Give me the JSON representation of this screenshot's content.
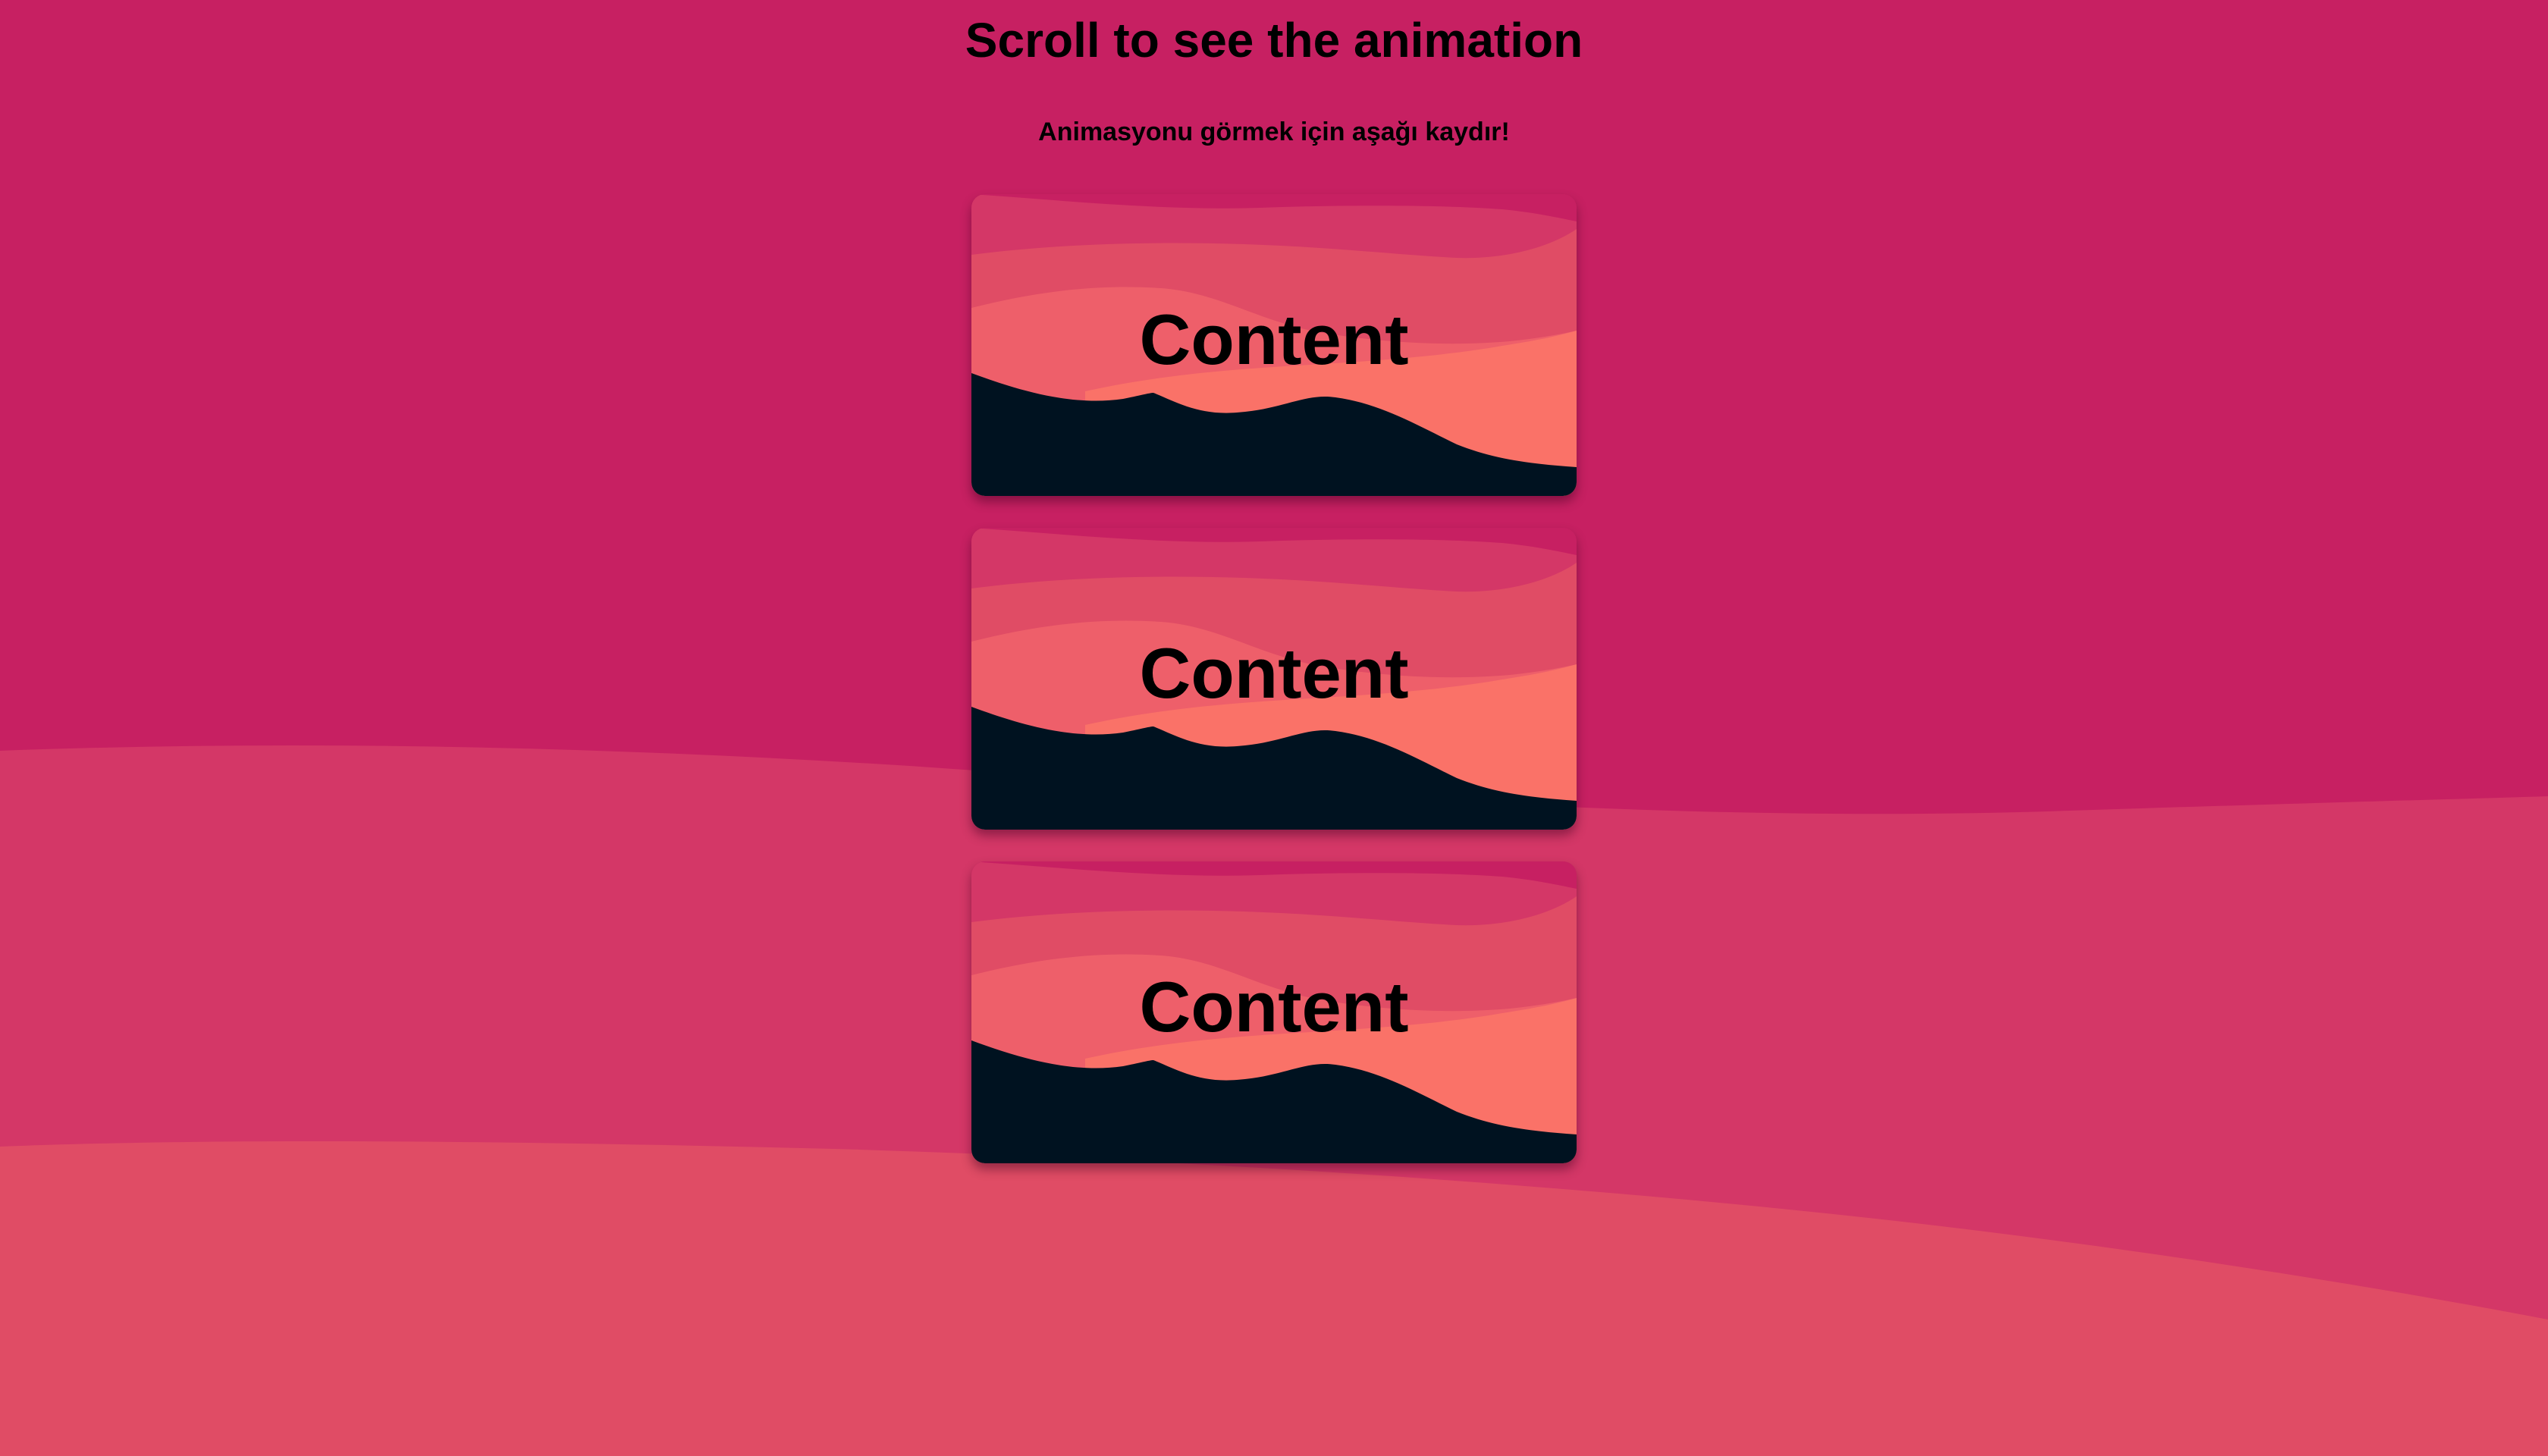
{
  "header": {
    "title": "Scroll to see the animation",
    "subtitle": "Animasyonu görmek için aşağı kaydır!"
  },
  "cards": [
    {
      "label": "Content"
    },
    {
      "label": "Content"
    },
    {
      "label": "Content"
    }
  ],
  "colors": {
    "background_top": "#c72062",
    "background_mid": "#d43767",
    "background_bottom": "#e04c65",
    "wave_1": "#d43767",
    "wave_2": "#e04c65",
    "wave_3": "#ee5f6a",
    "wave_4": "#fa7268",
    "wave_dark": "#001220"
  }
}
